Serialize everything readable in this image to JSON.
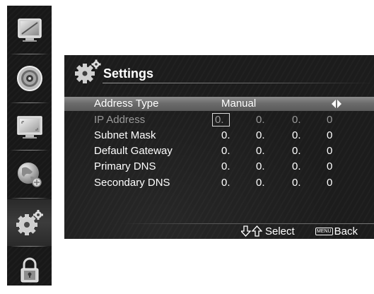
{
  "sidebar": {
    "items": [
      {
        "icon": "picture-icon"
      },
      {
        "icon": "speaker-icon"
      },
      {
        "icon": "screen-icon"
      },
      {
        "icon": "network-globe-icon"
      },
      {
        "icon": "settings-gear-icon",
        "active": true
      },
      {
        "icon": "lock-icon"
      }
    ]
  },
  "panel": {
    "title": "Settings",
    "rows": [
      {
        "label": "Address Type",
        "value": "Manual"
      },
      {
        "label": "IP Address",
        "octets": [
          "0.",
          "0.",
          "0.",
          "0"
        ]
      },
      {
        "label": "Subnet Mask",
        "octets": [
          "0.",
          "0.",
          "0.",
          "0"
        ]
      },
      {
        "label": "Default Gateway",
        "octets": [
          "0.",
          "0.",
          "0.",
          "0"
        ]
      },
      {
        "label": "Primary DNS",
        "octets": [
          "0.",
          "0.",
          "0.",
          "0"
        ]
      },
      {
        "label": "Secondary DNS",
        "octets": [
          "0.",
          "0.",
          "0.",
          "0"
        ]
      }
    ],
    "footer": {
      "select_label": "Select",
      "menu_key_label": "MENU",
      "back_label": "Back"
    }
  },
  "colors": {
    "panel_background": "#1c1c1c",
    "selected_row": "#6c6c6c",
    "dim_text": "#9a9a9a",
    "sidebar_background": "#181818"
  }
}
